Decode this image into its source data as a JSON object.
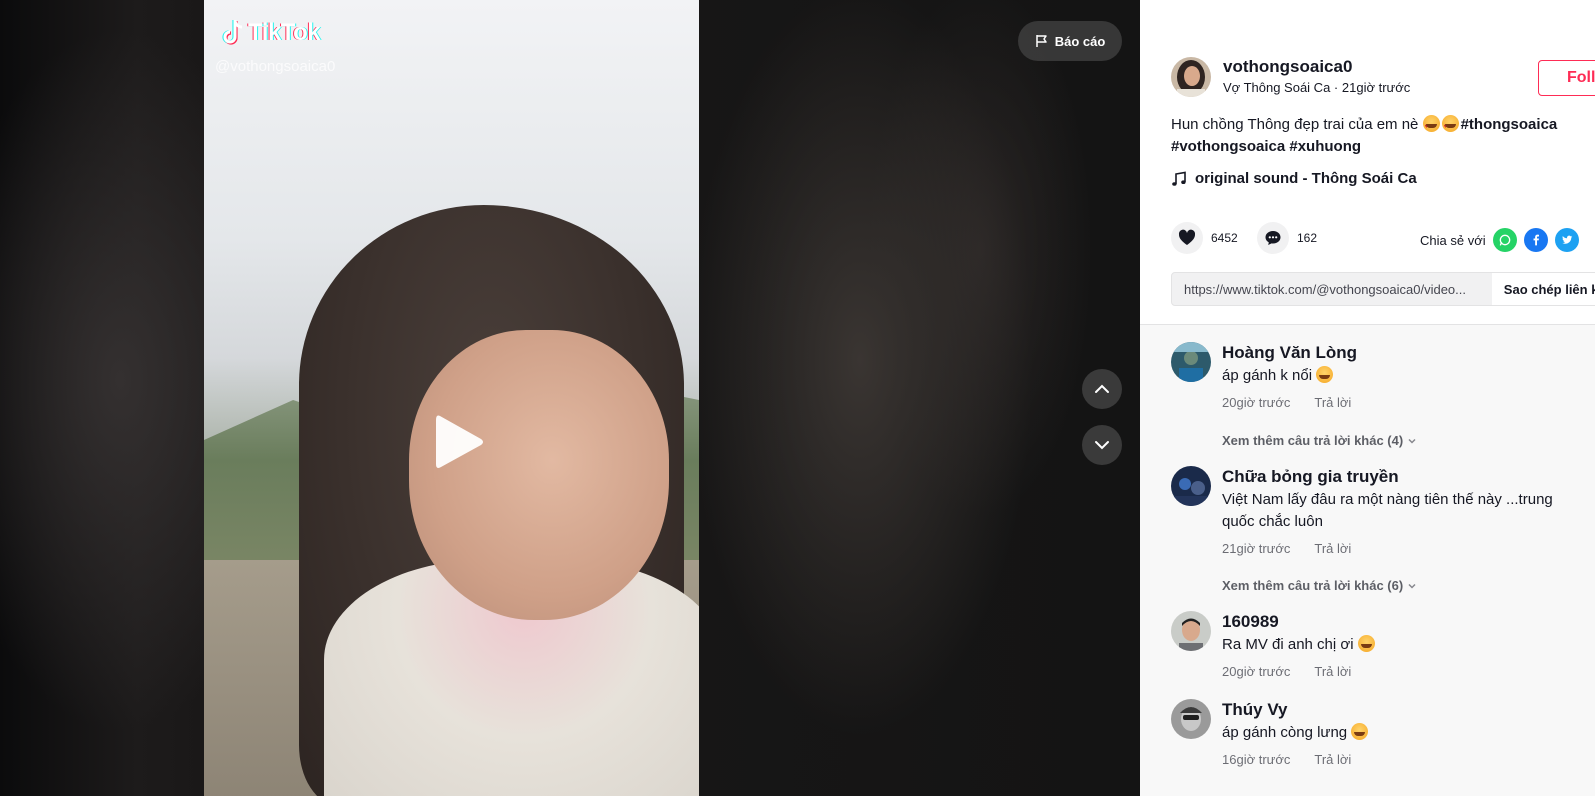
{
  "video": {
    "logo_text": "TikTok",
    "handle": "@vothongsoaica0",
    "report_label": "Báo cáo"
  },
  "post": {
    "author_username": "vothongsoaica0",
    "author_display": "Vợ Thông Soái Ca",
    "posted_time": "21giờ trước",
    "follow_label": "Follow",
    "caption_text": "Hun chồng Thông đẹp trai của em nè",
    "caption_emojis": [
      "heart-eyes-emoji",
      "heart-eyes-emoji"
    ],
    "hashtags": [
      "#thongsoaica",
      "#vothongsoaica",
      "#xuhuong"
    ],
    "music": "original sound - Thông Soái Ca",
    "likes": "6452",
    "comments": "162",
    "share_label": "Chia sẻ với",
    "share_targets": [
      "whatsapp-icon",
      "facebook-icon",
      "twitter-icon"
    ],
    "link": "https://www.tiktok.com/@vothongsoaica0/video...",
    "copy_label": "Sao chép liên kết"
  },
  "comments": [
    {
      "name": "Hoàng Văn Lòng",
      "text": "áp gánh k nổi",
      "emoji": "laughing-emoji",
      "time": "20giờ trước",
      "reply": "Trả lời",
      "more": "Xem thêm câu trả lời khác (4)"
    },
    {
      "name": "Chữa bỏng gia truyền",
      "text": "Việt Nam lấy đâu ra một nàng tiên thế này ...trung quốc chắc luôn",
      "emoji": "",
      "time": "21giờ trước",
      "reply": "Trả lời",
      "more": "Xem thêm câu trả lời khác (6)"
    },
    {
      "name": "160989",
      "text": "Ra MV đi anh chị ơi",
      "emoji": "grinning-emoji",
      "time": "20giờ trước",
      "reply": "Trả lời",
      "more": ""
    },
    {
      "name": "Thúy Vy",
      "text": "áp gánh còng lưng",
      "emoji": "laughing-emoji",
      "time": "16giờ trước",
      "reply": "Trả lời",
      "more": ""
    }
  ],
  "colors": {
    "accent": "#fe2c55",
    "whatsapp": "#25d366",
    "facebook": "#1877f2",
    "twitter": "#1da1f2"
  }
}
